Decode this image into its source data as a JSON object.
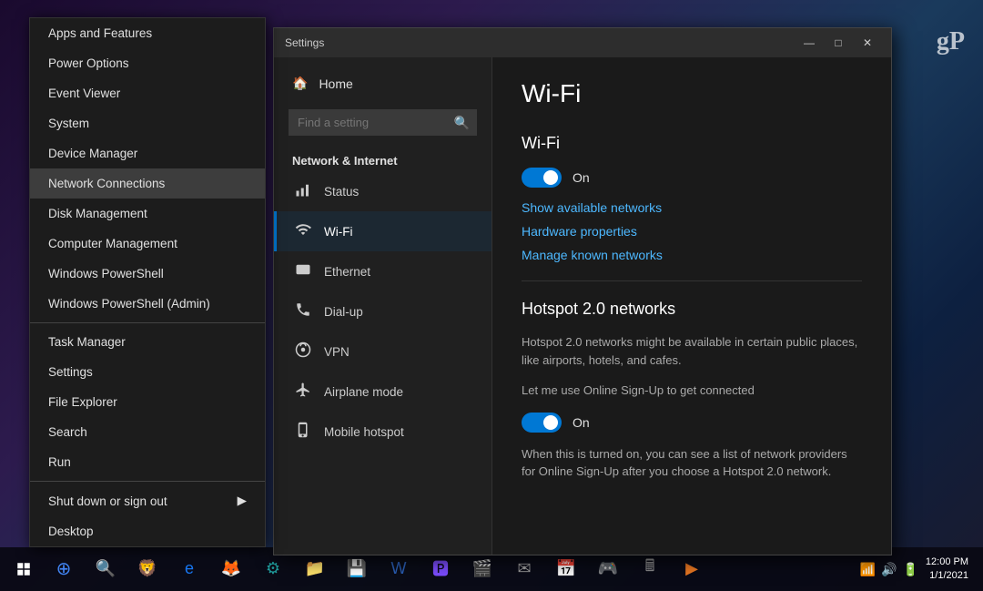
{
  "desktop": {
    "bg": "purple-cityscape"
  },
  "gp_logo": "gP",
  "context_menu": {
    "items": [
      {
        "id": "apps-features",
        "label": "Apps and Features",
        "active": false,
        "divider_after": false
      },
      {
        "id": "power-options",
        "label": "Power Options",
        "active": false,
        "divider_after": false
      },
      {
        "id": "event-viewer",
        "label": "Event Viewer",
        "active": false,
        "divider_after": false
      },
      {
        "id": "system",
        "label": "System",
        "active": false,
        "divider_after": false
      },
      {
        "id": "device-manager",
        "label": "Device Manager",
        "active": false,
        "divider_after": false
      },
      {
        "id": "network-connections",
        "label": "Network Connections",
        "active": true,
        "divider_after": false
      },
      {
        "id": "disk-management",
        "label": "Disk Management",
        "active": false,
        "divider_after": false
      },
      {
        "id": "computer-management",
        "label": "Computer Management",
        "active": false,
        "divider_after": false
      },
      {
        "id": "windows-powershell",
        "label": "Windows PowerShell",
        "active": false,
        "divider_after": false
      },
      {
        "id": "windows-powershell-admin",
        "label": "Windows PowerShell (Admin)",
        "active": false,
        "divider_after": true
      }
    ],
    "items2": [
      {
        "id": "task-manager",
        "label": "Task Manager",
        "active": false
      },
      {
        "id": "settings",
        "label": "Settings",
        "active": false
      },
      {
        "id": "file-explorer",
        "label": "File Explorer",
        "active": false
      },
      {
        "id": "search",
        "label": "Search",
        "active": false
      },
      {
        "id": "run",
        "label": "Run",
        "active": false
      }
    ],
    "items3": [
      {
        "id": "shut-down-sign-out",
        "label": "Shut down or sign out",
        "has_arrow": true
      },
      {
        "id": "desktop",
        "label": "Desktop",
        "has_arrow": false
      }
    ]
  },
  "settings_window": {
    "title": "Settings",
    "search_placeholder": "Find a setting",
    "home_label": "Home",
    "section_title": "Network & Internet",
    "nav_items": [
      {
        "id": "status",
        "label": "Status",
        "icon": "📶",
        "active": false
      },
      {
        "id": "wifi",
        "label": "Wi-Fi",
        "icon": "📡",
        "active": true
      },
      {
        "id": "ethernet",
        "label": "Ethernet",
        "icon": "🔌",
        "active": false
      },
      {
        "id": "dialup",
        "label": "Dial-up",
        "icon": "☎",
        "active": false
      },
      {
        "id": "vpn",
        "label": "VPN",
        "icon": "🔒",
        "active": false
      },
      {
        "id": "airplane-mode",
        "label": "Airplane mode",
        "icon": "✈",
        "active": false
      },
      {
        "id": "mobile-hotspot",
        "label": "Mobile hotspot",
        "icon": "📶",
        "active": false
      }
    ],
    "window_controls": {
      "minimize": "—",
      "restore": "□",
      "close": "✕"
    }
  },
  "wifi_page": {
    "title": "Wi-Fi",
    "wifi_section_title": "Wi-Fi",
    "toggle_on_label": "On",
    "show_networks_link": "Show available networks",
    "hardware_props_link": "Hardware properties",
    "manage_networks_link": "Manage known networks",
    "hotspot_section_title": "Hotspot 2.0 networks",
    "hotspot_desc1": "Hotspot 2.0 networks might be available in certain public places, like airports, hotels, and cafes.",
    "hotspot_desc2": "Let me use Online Sign-Up to get connected",
    "hotspot_toggle_label": "On",
    "hotspot_desc3": "When this is turned on, you can see a list of network providers for Online Sign-Up after you choose a Hotspot 2.0 network."
  },
  "taskbar": {
    "icons": [
      {
        "id": "chrome",
        "label": "Chrome",
        "color": "chrome"
      },
      {
        "id": "search-cortana",
        "label": "Search",
        "color": "yellow"
      },
      {
        "id": "brave",
        "label": "Brave",
        "color": "orange"
      },
      {
        "id": "edge",
        "label": "Edge",
        "color": "blue"
      },
      {
        "id": "firefox",
        "label": "Firefox",
        "color": "red"
      },
      {
        "id": "app6",
        "label": "App",
        "color": "teal"
      },
      {
        "id": "app7",
        "label": "App",
        "color": "green"
      },
      {
        "id": "app8",
        "label": "App",
        "color": "green"
      },
      {
        "id": "word",
        "label": "Word",
        "color": "word"
      },
      {
        "id": "app10",
        "label": "App",
        "color": "purple"
      },
      {
        "id": "app11",
        "label": "App",
        "color": "cyan"
      },
      {
        "id": "mail",
        "label": "Mail",
        "color": "gray"
      },
      {
        "id": "calendar",
        "label": "Calendar",
        "color": "cyan"
      },
      {
        "id": "app14",
        "label": "App",
        "color": "green"
      },
      {
        "id": "calculator",
        "label": "Calculator",
        "color": "gray"
      },
      {
        "id": "vlc",
        "label": "VLC",
        "color": "orange"
      }
    ],
    "time": "12:00 PM",
    "date": "1/1/2021"
  }
}
